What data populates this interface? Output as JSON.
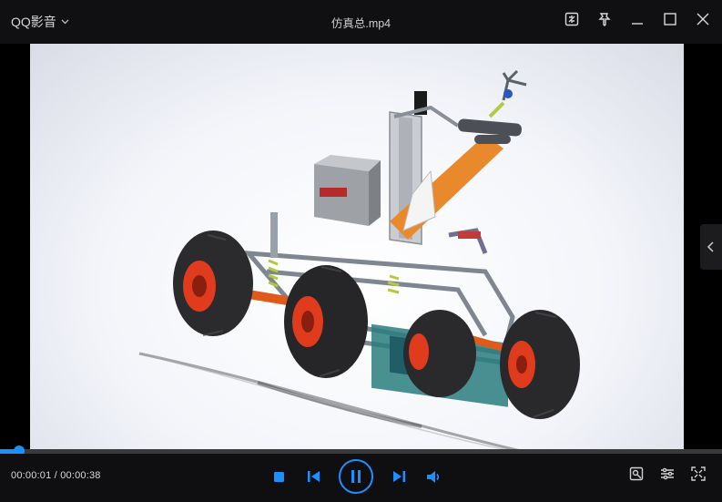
{
  "app": {
    "menu_label": "QQ影音",
    "menu_icon": "chevron-down-icon"
  },
  "file": {
    "title": "仿真总.mp4"
  },
  "window_buttons": [
    "screenshot-frame-icon",
    "pin-icon",
    "minimize-icon",
    "maximize-icon",
    "close-icon"
  ],
  "video": {
    "scene": "3d-rover-robot-arm-render",
    "sidebar_toggle_icon": "chevron-left-icon"
  },
  "playback": {
    "current_time": "00:00:01",
    "separator": " / ",
    "total_time": "00:00:38",
    "progress_fraction": 0.026,
    "state": "playing"
  },
  "controls": {
    "center": [
      "stop-icon",
      "previous-icon",
      "pause-icon",
      "next-icon",
      "volume-icon"
    ],
    "right": [
      "picture-quality-icon",
      "settings-sliders-icon",
      "fullscreen-icon"
    ]
  },
  "colors": {
    "accent": "#1e8fff",
    "titlebar_bg": "#101012",
    "controls_bg": "#0f0f11"
  }
}
